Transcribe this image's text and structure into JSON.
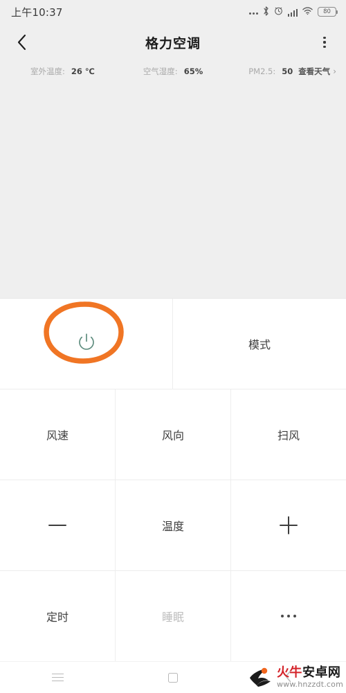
{
  "statusbar": {
    "time": "上午10:37",
    "icons": {
      "overflow": "more-dots-icon",
      "bluetooth": "bluetooth-icon",
      "alarm": "alarm-clock-icon",
      "signal": "signal-bars-icon",
      "wifi": "wifi-icon",
      "battery": "battery-icon"
    },
    "battery_level": "80"
  },
  "titlebar": {
    "back": "back-chevron-icon",
    "title": "格力空调",
    "menu": "overflow-menu-icon"
  },
  "weather": {
    "outdoor_temp_label": "室外温度:",
    "outdoor_temp_value": "26 ℃",
    "humidity_label": "空气湿度:",
    "humidity_value": "65%",
    "pm25_label": "PM2.5:",
    "pm25_value": "50",
    "link_label": "查看天气",
    "link_chevron": "›"
  },
  "controls": {
    "row1": [
      {
        "name": "power",
        "label": "",
        "icon": "power-icon",
        "dim": false
      },
      {
        "name": "mode",
        "label": "模式",
        "icon": "",
        "dim": false
      }
    ],
    "row2": [
      {
        "name": "fan-speed",
        "label": "风速",
        "icon": "",
        "dim": false
      },
      {
        "name": "wind-direction",
        "label": "风向",
        "icon": "",
        "dim": false
      },
      {
        "name": "swing",
        "label": "扫风",
        "icon": "",
        "dim": false
      }
    ],
    "row3": [
      {
        "name": "temp-decrease",
        "label": "",
        "icon": "minus-icon",
        "dim": false
      },
      {
        "name": "temperature",
        "label": "温度",
        "icon": "",
        "dim": false
      },
      {
        "name": "temp-increase",
        "label": "",
        "icon": "plus-icon",
        "dim": false
      }
    ],
    "row4": [
      {
        "name": "timer",
        "label": "定时",
        "icon": "",
        "dim": false
      },
      {
        "name": "sleep",
        "label": "睡眠",
        "icon": "",
        "dim": true
      },
      {
        "name": "more",
        "label": "",
        "icon": "more-dots-icon",
        "dim": false
      }
    ]
  },
  "annotation": {
    "shape": "hand-drawn-ellipse",
    "color": "#f07524",
    "targets": "power-button"
  },
  "navbar": {
    "menu": "hamburger-icon",
    "home": "square-icon",
    "back": "back-chevron-icon"
  },
  "watermark": {
    "brand_red": "火牛",
    "brand_black": "安卓网",
    "url": "www.hnzzdt.com",
    "logo": "bull-logo-icon"
  },
  "colors": {
    "accent_orange": "#f07524",
    "power_teal": "#5f8d7f",
    "bg_gray": "#efefef",
    "panel_white": "#ffffff",
    "text_dark": "#3d3d3d",
    "text_dim": "#bdbdbd"
  }
}
